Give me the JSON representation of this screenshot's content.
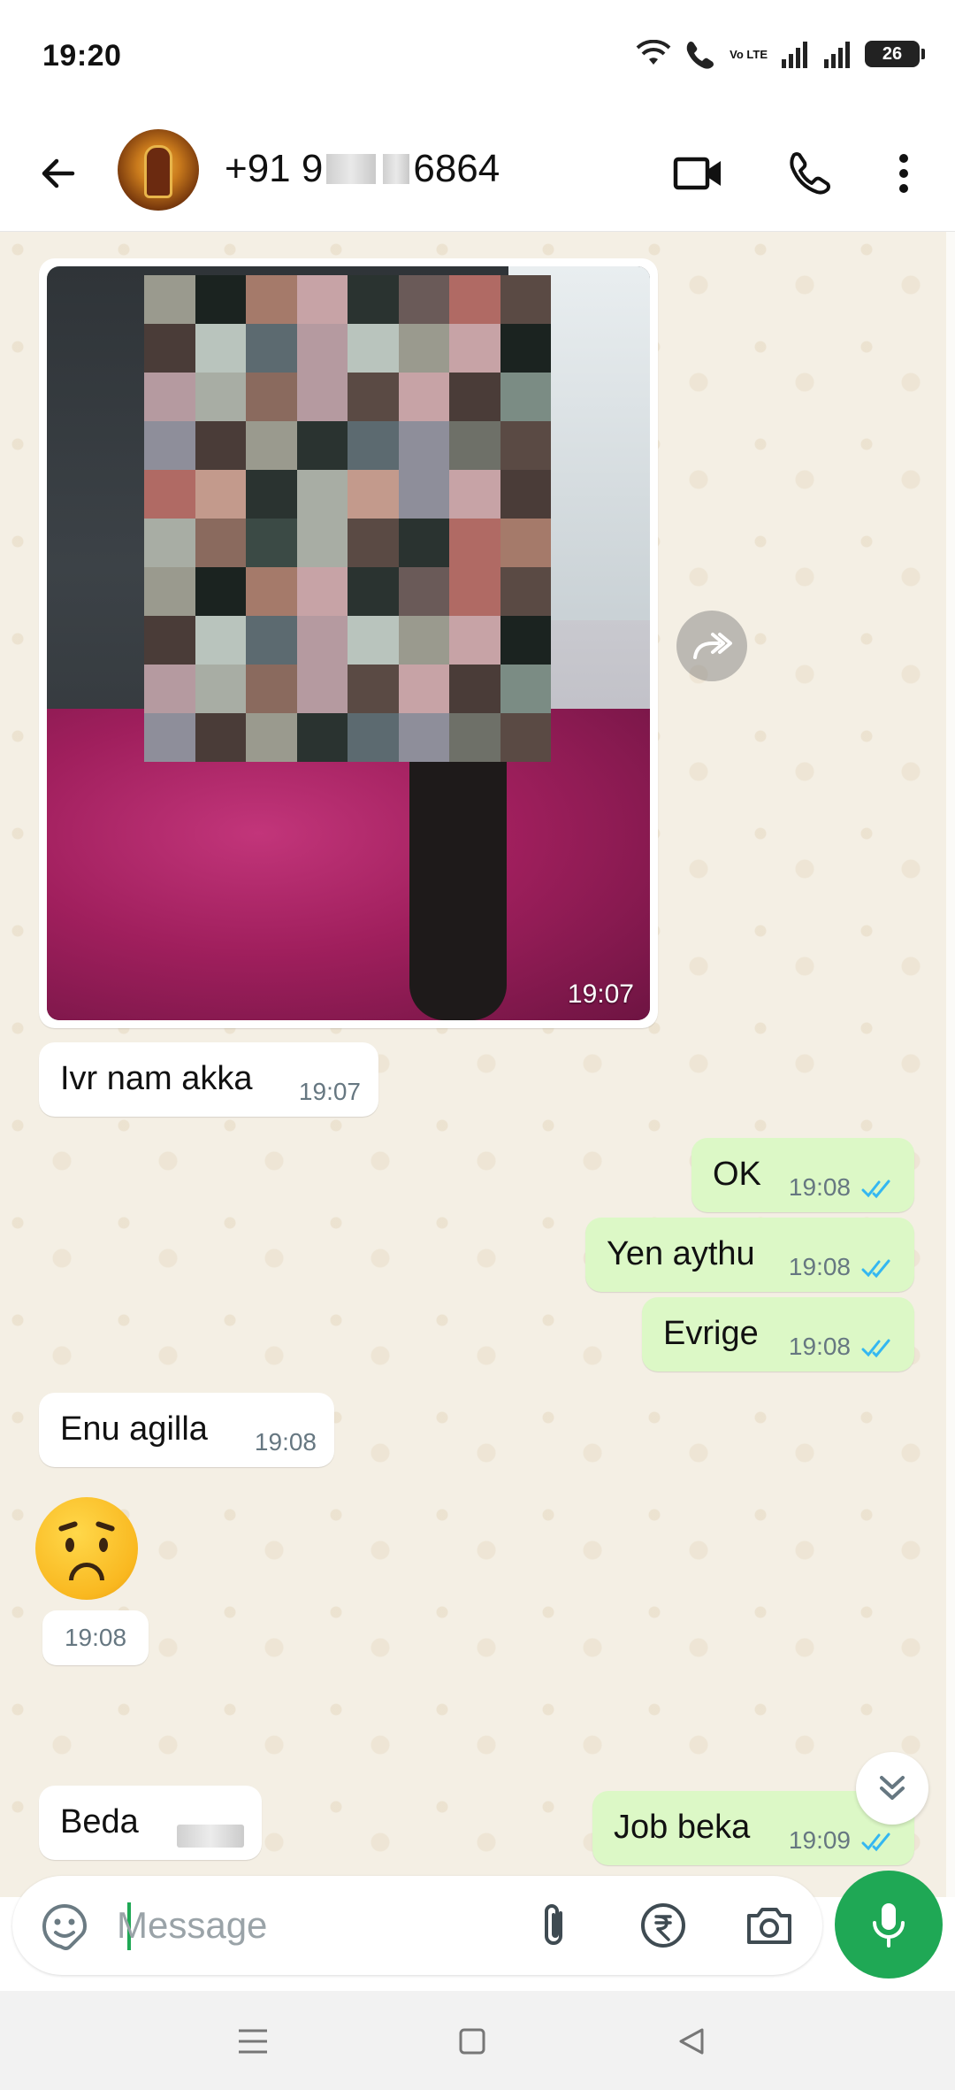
{
  "status_bar": {
    "time": "19:20",
    "volte": "Vo LTE",
    "battery": "26"
  },
  "header": {
    "contact_prefix": "+91 9",
    "contact_middle": "",
    "contact_suffix": "6864",
    "icons": [
      "back-arrow-icon",
      "video-call-icon",
      "phone-icon",
      "more-vert-icon"
    ]
  },
  "messages": [
    {
      "dir": "in",
      "type": "image",
      "time": "19:07"
    },
    {
      "dir": "in",
      "text": "Ivr nam akka",
      "time": "19:07"
    },
    {
      "dir": "out",
      "text": "OK",
      "time": "19:08",
      "status": "read"
    },
    {
      "dir": "out",
      "text": "Yen aythu",
      "time": "19:08",
      "status": "read"
    },
    {
      "dir": "out",
      "text": "Evrige",
      "time": "19:08",
      "status": "read"
    },
    {
      "dir": "in",
      "text": "Enu agilla",
      "time": "19:08"
    },
    {
      "dir": "in",
      "type": "emoji",
      "emoji": "worried-face",
      "time": "19:08"
    },
    {
      "dir": "out",
      "text": "Job beka",
      "time": "19:09",
      "status": "read"
    },
    {
      "dir": "in",
      "text": "Beda",
      "time": ""
    }
  ],
  "composer": {
    "placeholder": "Message",
    "icons": [
      "sticker-icon",
      "attach-icon",
      "rupee-payment-icon",
      "camera-icon",
      "mic-icon"
    ]
  },
  "colors": {
    "outgoing_bubble": "#dcf8c6",
    "incoming_bubble": "#ffffff",
    "chat_bg": "#f4efe4",
    "read_ticks": "#34b7f1",
    "accent": "#1fa855"
  }
}
